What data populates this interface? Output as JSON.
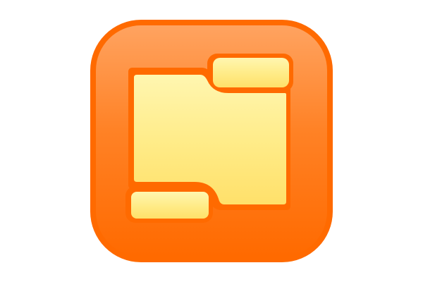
{
  "app_icon": {
    "icon": "folder-split-icon",
    "colors": {
      "frame_outer": "#ff6a00",
      "frame_inner": "#ff8a2a",
      "frame_highlight": "#ffa360",
      "panel_light": "#fff6b0",
      "panel_mid": "#ffeb86",
      "panel_dark": "#ffe06a"
    }
  }
}
